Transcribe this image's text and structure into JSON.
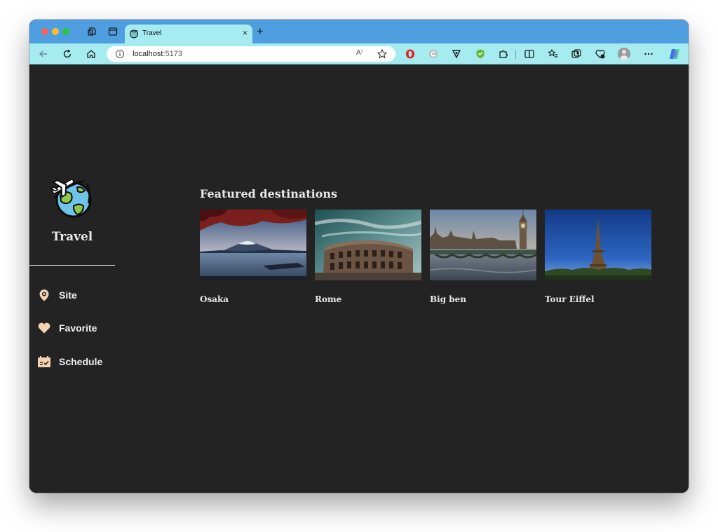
{
  "browser": {
    "tab": {
      "title": "Travel",
      "close": "×"
    },
    "new_tab": "+",
    "address": {
      "host": "localhost",
      "port": ":5173",
      "read_aloud": "A⁾"
    },
    "accent_colors": {
      "tab_strip": "#4f9fe0",
      "toolbar": "#a6ebf0"
    }
  },
  "sidebar": {
    "brand": "Travel",
    "items": [
      {
        "label": "Site",
        "icon": "location-pin-icon"
      },
      {
        "label": "Favorite",
        "icon": "heart-icon"
      },
      {
        "label": "Schedule",
        "icon": "calendar-check-icon"
      }
    ]
  },
  "main": {
    "heading": "Featured destinations",
    "destinations": [
      {
        "name": "Osaka",
        "image": "mount-fuji-lake-photo"
      },
      {
        "name": "Rome",
        "image": "colosseum-photo"
      },
      {
        "name": "Big ben",
        "image": "big-ben-westminster-photo"
      },
      {
        "name": "Tour Eiffel",
        "image": "eiffel-tower-photo"
      }
    ]
  }
}
